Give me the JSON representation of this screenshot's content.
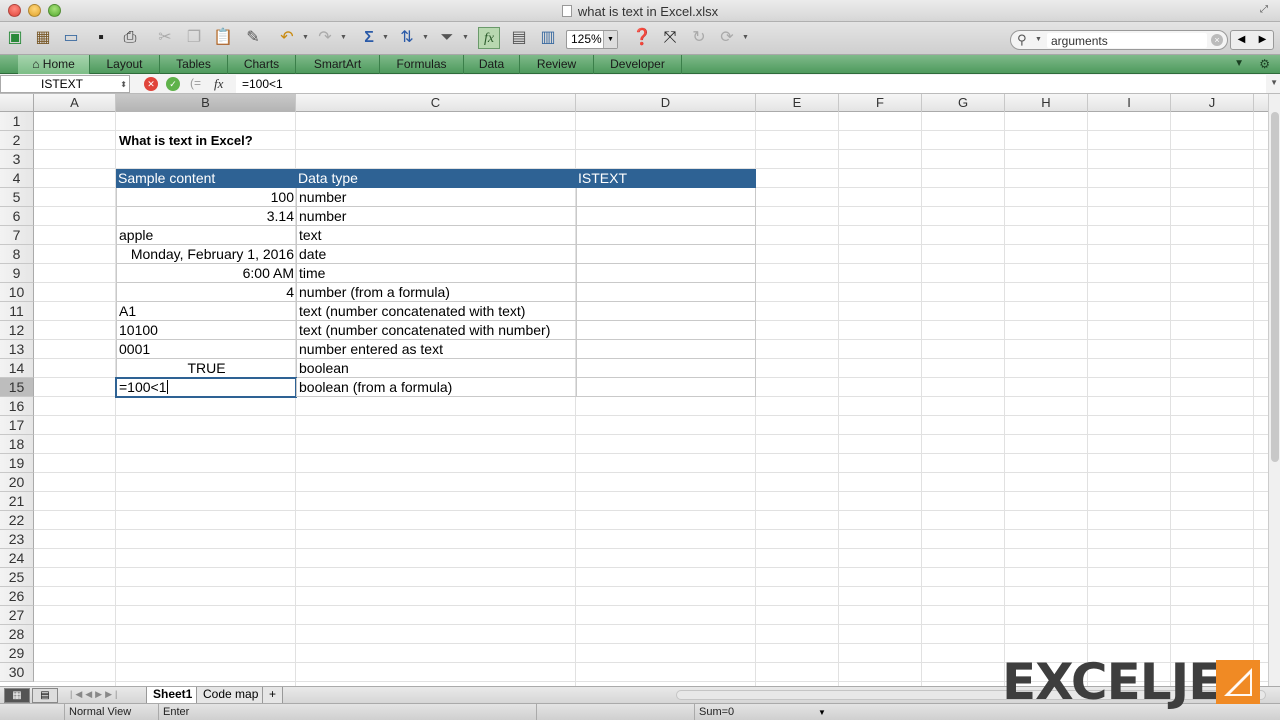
{
  "window": {
    "title": "what is text in Excel.xlsx"
  },
  "toolbar": {
    "zoom": "125%",
    "search_value": "arguments"
  },
  "ribbon": {
    "tabs": [
      "Home",
      "Layout",
      "Tables",
      "Charts",
      "SmartArt",
      "Formulas",
      "Data",
      "Review",
      "Developer"
    ]
  },
  "formula_bar": {
    "name_box": "ISTEXT",
    "fx_label": "fx",
    "formula": "=100<1"
  },
  "grid": {
    "columns": [
      "A",
      "B",
      "C",
      "D",
      "E",
      "F",
      "G",
      "H",
      "I",
      "J"
    ],
    "rows": [
      "1",
      "2",
      "3",
      "4",
      "5",
      "6",
      "7",
      "8",
      "9",
      "10",
      "11",
      "12",
      "13",
      "14",
      "15",
      "16",
      "17",
      "18",
      "19",
      "20",
      "21",
      "22",
      "23",
      "24",
      "25",
      "26",
      "27",
      "28",
      "29",
      "30"
    ],
    "active_column": "B",
    "active_row": "15"
  },
  "sheet": {
    "title": "What is text in Excel?",
    "table": {
      "headers": [
        "Sample content",
        "Data type",
        "ISTEXT"
      ],
      "rows": [
        {
          "content": "100",
          "type": "number",
          "align": "r"
        },
        {
          "content": "3.14",
          "type": "number",
          "align": "r"
        },
        {
          "content": "apple",
          "type": "text",
          "align": "l"
        },
        {
          "content": "Monday, February 1, 2016",
          "type": "date",
          "align": "r"
        },
        {
          "content": "6:00 AM",
          "type": "time",
          "align": "r"
        },
        {
          "content": "4",
          "type": "number (from a formula)",
          "align": "r"
        },
        {
          "content": "A1",
          "type": "text (number concatenated with text)",
          "align": "l"
        },
        {
          "content": "10100",
          "type": "text (number concatenated with number)",
          "align": "l"
        },
        {
          "content": "0001",
          "type": "number entered as text",
          "align": "l"
        },
        {
          "content": "TRUE",
          "type": "boolean",
          "align": "c"
        },
        {
          "content": "=100<1",
          "type": "boolean (from a formula)",
          "align": "l"
        }
      ]
    }
  },
  "sheet_tabs": [
    "Sheet1",
    "Code map",
    "+"
  ],
  "status_bar": {
    "view": "Normal View",
    "mode": "Enter",
    "sum": "Sum=0"
  },
  "logo": {
    "text": "EXCELJET"
  },
  "colors": {
    "header_blue": "#2e6294",
    "ribbon_green": "#4e9a5d",
    "logo_orange": "#f08a24"
  }
}
